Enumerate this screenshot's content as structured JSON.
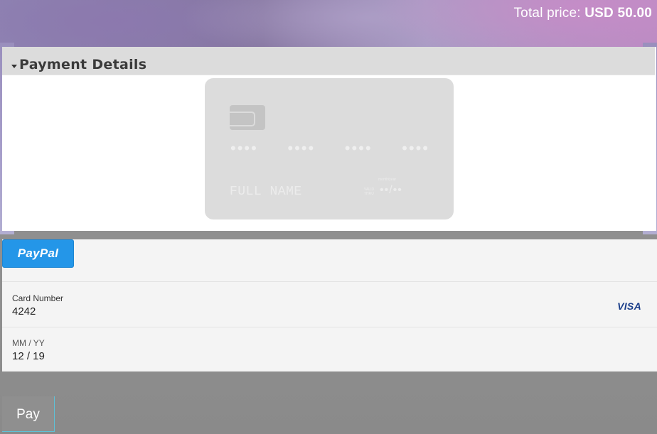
{
  "header": {
    "total_label": "Total price:",
    "total_amount": "USD 50.00"
  },
  "payment_details": {
    "title": "Payment Details"
  },
  "card_preview": {
    "number_groups": [
      "••••",
      "••••",
      "••••",
      "••••"
    ],
    "name_placeholder": "FULL NAME",
    "valid_thru": "valid thru",
    "month_year": "month/year",
    "expiry_placeholder": "••/••"
  },
  "paypal": {
    "label": "PayPal"
  },
  "card_number": {
    "label": "Card Number",
    "value": "4242",
    "brand": "VISA"
  },
  "expiry": {
    "label": "MM / YY",
    "value": "12 / 19"
  },
  "pay_button": {
    "label": "Pay"
  },
  "colors": {
    "paypal_blue": "#2496e8",
    "visa_blue": "#1a3e8a",
    "pay_button_border": "#5fc1d6"
  }
}
